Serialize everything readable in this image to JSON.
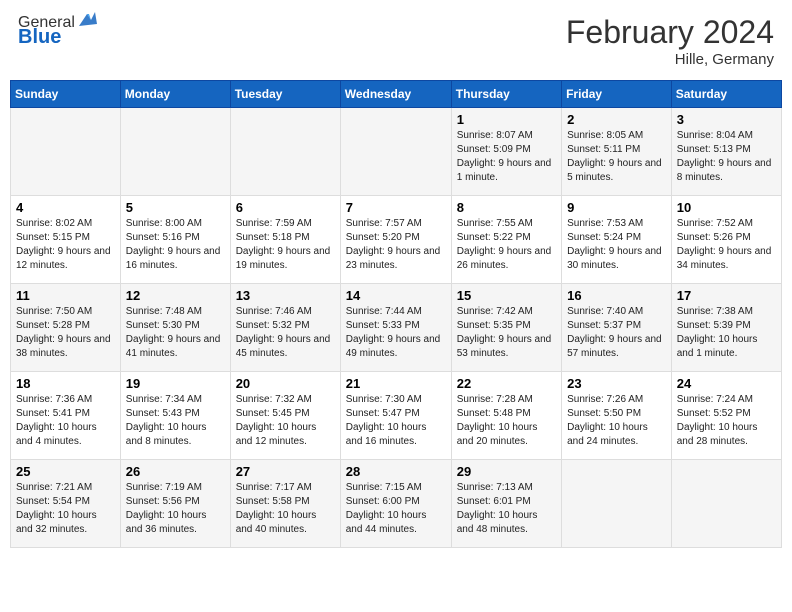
{
  "header": {
    "logo_general": "General",
    "logo_blue": "Blue",
    "title": "February 2024",
    "subtitle": "Hille, Germany"
  },
  "columns": [
    "Sunday",
    "Monday",
    "Tuesday",
    "Wednesday",
    "Thursday",
    "Friday",
    "Saturday"
  ],
  "weeks": [
    [
      {
        "day": "",
        "sunrise": "",
        "sunset": "",
        "daylight": ""
      },
      {
        "day": "",
        "sunrise": "",
        "sunset": "",
        "daylight": ""
      },
      {
        "day": "",
        "sunrise": "",
        "sunset": "",
        "daylight": ""
      },
      {
        "day": "",
        "sunrise": "",
        "sunset": "",
        "daylight": ""
      },
      {
        "day": "1",
        "sunrise": "Sunrise: 8:07 AM",
        "sunset": "Sunset: 5:09 PM",
        "daylight": "Daylight: 9 hours and 1 minute."
      },
      {
        "day": "2",
        "sunrise": "Sunrise: 8:05 AM",
        "sunset": "Sunset: 5:11 PM",
        "daylight": "Daylight: 9 hours and 5 minutes."
      },
      {
        "day": "3",
        "sunrise": "Sunrise: 8:04 AM",
        "sunset": "Sunset: 5:13 PM",
        "daylight": "Daylight: 9 hours and 8 minutes."
      }
    ],
    [
      {
        "day": "4",
        "sunrise": "Sunrise: 8:02 AM",
        "sunset": "Sunset: 5:15 PM",
        "daylight": "Daylight: 9 hours and 12 minutes."
      },
      {
        "day": "5",
        "sunrise": "Sunrise: 8:00 AM",
        "sunset": "Sunset: 5:16 PM",
        "daylight": "Daylight: 9 hours and 16 minutes."
      },
      {
        "day": "6",
        "sunrise": "Sunrise: 7:59 AM",
        "sunset": "Sunset: 5:18 PM",
        "daylight": "Daylight: 9 hours and 19 minutes."
      },
      {
        "day": "7",
        "sunrise": "Sunrise: 7:57 AM",
        "sunset": "Sunset: 5:20 PM",
        "daylight": "Daylight: 9 hours and 23 minutes."
      },
      {
        "day": "8",
        "sunrise": "Sunrise: 7:55 AM",
        "sunset": "Sunset: 5:22 PM",
        "daylight": "Daylight: 9 hours and 26 minutes."
      },
      {
        "day": "9",
        "sunrise": "Sunrise: 7:53 AM",
        "sunset": "Sunset: 5:24 PM",
        "daylight": "Daylight: 9 hours and 30 minutes."
      },
      {
        "day": "10",
        "sunrise": "Sunrise: 7:52 AM",
        "sunset": "Sunset: 5:26 PM",
        "daylight": "Daylight: 9 hours and 34 minutes."
      }
    ],
    [
      {
        "day": "11",
        "sunrise": "Sunrise: 7:50 AM",
        "sunset": "Sunset: 5:28 PM",
        "daylight": "Daylight: 9 hours and 38 minutes."
      },
      {
        "day": "12",
        "sunrise": "Sunrise: 7:48 AM",
        "sunset": "Sunset: 5:30 PM",
        "daylight": "Daylight: 9 hours and 41 minutes."
      },
      {
        "day": "13",
        "sunrise": "Sunrise: 7:46 AM",
        "sunset": "Sunset: 5:32 PM",
        "daylight": "Daylight: 9 hours and 45 minutes."
      },
      {
        "day": "14",
        "sunrise": "Sunrise: 7:44 AM",
        "sunset": "Sunset: 5:33 PM",
        "daylight": "Daylight: 9 hours and 49 minutes."
      },
      {
        "day": "15",
        "sunrise": "Sunrise: 7:42 AM",
        "sunset": "Sunset: 5:35 PM",
        "daylight": "Daylight: 9 hours and 53 minutes."
      },
      {
        "day": "16",
        "sunrise": "Sunrise: 7:40 AM",
        "sunset": "Sunset: 5:37 PM",
        "daylight": "Daylight: 9 hours and 57 minutes."
      },
      {
        "day": "17",
        "sunrise": "Sunrise: 7:38 AM",
        "sunset": "Sunset: 5:39 PM",
        "daylight": "Daylight: 10 hours and 1 minute."
      }
    ],
    [
      {
        "day": "18",
        "sunrise": "Sunrise: 7:36 AM",
        "sunset": "Sunset: 5:41 PM",
        "daylight": "Daylight: 10 hours and 4 minutes."
      },
      {
        "day": "19",
        "sunrise": "Sunrise: 7:34 AM",
        "sunset": "Sunset: 5:43 PM",
        "daylight": "Daylight: 10 hours and 8 minutes."
      },
      {
        "day": "20",
        "sunrise": "Sunrise: 7:32 AM",
        "sunset": "Sunset: 5:45 PM",
        "daylight": "Daylight: 10 hours and 12 minutes."
      },
      {
        "day": "21",
        "sunrise": "Sunrise: 7:30 AM",
        "sunset": "Sunset: 5:47 PM",
        "daylight": "Daylight: 10 hours and 16 minutes."
      },
      {
        "day": "22",
        "sunrise": "Sunrise: 7:28 AM",
        "sunset": "Sunset: 5:48 PM",
        "daylight": "Daylight: 10 hours and 20 minutes."
      },
      {
        "day": "23",
        "sunrise": "Sunrise: 7:26 AM",
        "sunset": "Sunset: 5:50 PM",
        "daylight": "Daylight: 10 hours and 24 minutes."
      },
      {
        "day": "24",
        "sunrise": "Sunrise: 7:24 AM",
        "sunset": "Sunset: 5:52 PM",
        "daylight": "Daylight: 10 hours and 28 minutes."
      }
    ],
    [
      {
        "day": "25",
        "sunrise": "Sunrise: 7:21 AM",
        "sunset": "Sunset: 5:54 PM",
        "daylight": "Daylight: 10 hours and 32 minutes."
      },
      {
        "day": "26",
        "sunrise": "Sunrise: 7:19 AM",
        "sunset": "Sunset: 5:56 PM",
        "daylight": "Daylight: 10 hours and 36 minutes."
      },
      {
        "day": "27",
        "sunrise": "Sunrise: 7:17 AM",
        "sunset": "Sunset: 5:58 PM",
        "daylight": "Daylight: 10 hours and 40 minutes."
      },
      {
        "day": "28",
        "sunrise": "Sunrise: 7:15 AM",
        "sunset": "Sunset: 6:00 PM",
        "daylight": "Daylight: 10 hours and 44 minutes."
      },
      {
        "day": "29",
        "sunrise": "Sunrise: 7:13 AM",
        "sunset": "Sunset: 6:01 PM",
        "daylight": "Daylight: 10 hours and 48 minutes."
      },
      {
        "day": "",
        "sunrise": "",
        "sunset": "",
        "daylight": ""
      },
      {
        "day": "",
        "sunrise": "",
        "sunset": "",
        "daylight": ""
      }
    ]
  ]
}
